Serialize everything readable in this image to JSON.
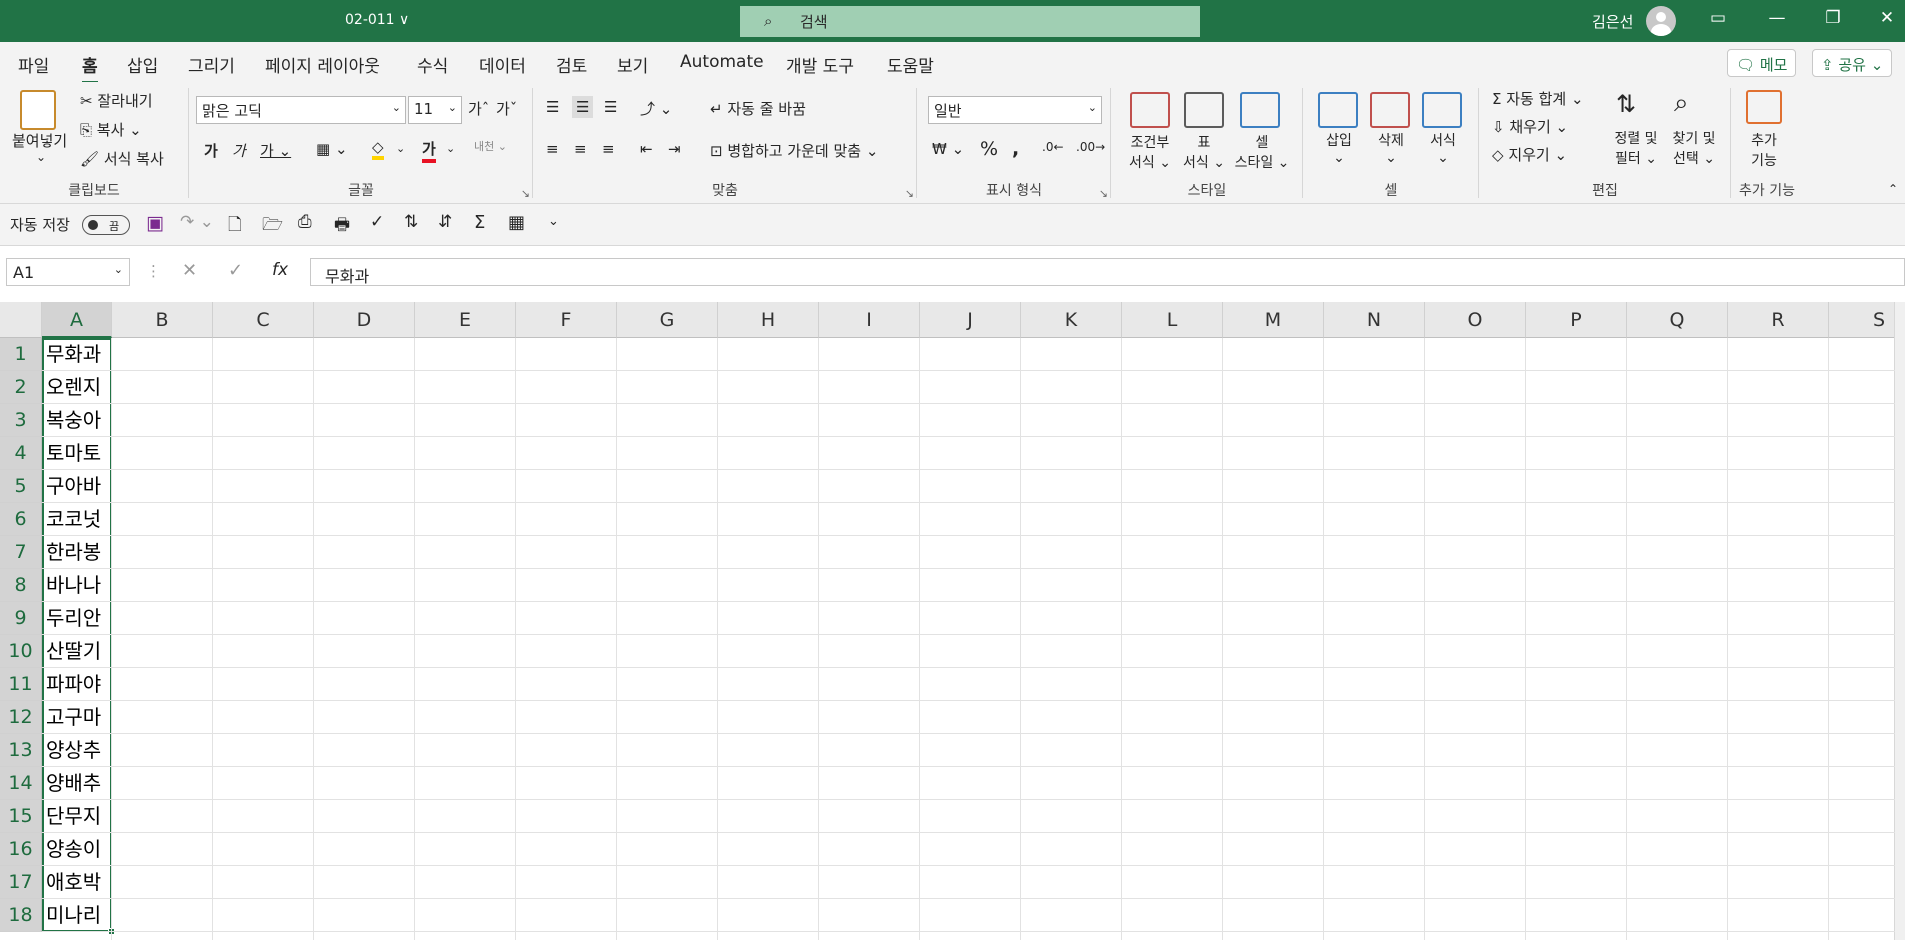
{
  "title": {
    "filename": "02-011 ∨",
    "search_placeholder": "검색",
    "user": "김은선"
  },
  "tabs": [
    "파일",
    "홈",
    "삽입",
    "그리기",
    "페이지 레이아웃",
    "수식",
    "데이터",
    "검토",
    "보기",
    "Automate",
    "개발 도구",
    "도움말"
  ],
  "top_buttons": {
    "memo": "메모",
    "share": "공유"
  },
  "clipboard": {
    "paste": "붙여넣기",
    "cut": "잘라내기",
    "copy": "복사",
    "format_painter": "서식 복사",
    "label": "클립보드"
  },
  "font": {
    "name": "맑은 고딕",
    "size": "11",
    "label": "글꼴"
  },
  "alignment": {
    "wrap": "자동 줄 바꿈",
    "merge": "병합하고 가운데 맞춤",
    "label": "맞춤"
  },
  "number": {
    "format": "일반",
    "label": "표시 형식"
  },
  "styles": {
    "conditional": "조건부\n서식",
    "table": "표\n서식",
    "cell": "셀\n스타일",
    "label": "스타일",
    "cond1": "조건부",
    "cond2": "서식",
    "tbl1": "표",
    "tbl2": "서식",
    "cell1": "셀",
    "cell2": "스타일"
  },
  "cells": {
    "insert": "삽입",
    "delete": "삭제",
    "format": "서식",
    "label": "셀"
  },
  "editing": {
    "autosum": "자동 합계",
    "fill": "채우기",
    "clear": "지우기",
    "sort1": "정렬 및",
    "sort2": "필터",
    "find1": "찾기 및",
    "find2": "선택",
    "label": "편집"
  },
  "addins": {
    "line1": "추가",
    "line2": "기능",
    "label": "추가 기능"
  },
  "qat": {
    "autosave": "자동 저장",
    "toggle": "끔"
  },
  "formula_bar": {
    "name_box": "A1",
    "content": "무화과"
  },
  "columns": [
    "A",
    "B",
    "C",
    "D",
    "E",
    "F",
    "G",
    "H",
    "I",
    "J",
    "K",
    "L",
    "M",
    "N",
    "O",
    "P",
    "Q",
    "R",
    "S"
  ],
  "rows": [
    "1",
    "2",
    "3",
    "4",
    "5",
    "6",
    "7",
    "8",
    "9",
    "10",
    "11",
    "12",
    "13",
    "14",
    "15",
    "16",
    "17",
    "18"
  ],
  "column_a": [
    "무화과",
    "오렌지",
    "복숭아",
    "토마토",
    "구아바",
    "코코넛",
    "한라봉",
    "바나나",
    "두리안",
    "산딸기",
    "파파야",
    "고구마",
    "양상추",
    "양배추",
    "단무지",
    "양송이",
    "애호박",
    "미나리"
  ],
  "colors": {
    "accent": "#217346",
    "title_bg": "#217346"
  }
}
